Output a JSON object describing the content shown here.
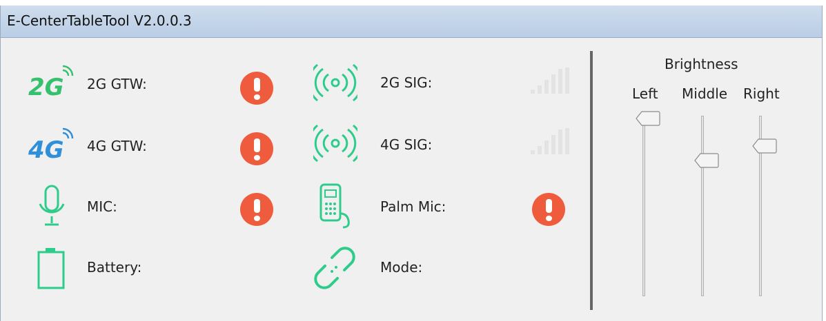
{
  "window": {
    "title": "E-CenterTableTool V2.0.0.3"
  },
  "status": {
    "gtw2g": {
      "label": "2G GTW:",
      "icon": "2g-signal-icon",
      "state": "alert"
    },
    "gtw4g": {
      "label": "4G GTW:",
      "icon": "4g-signal-icon",
      "state": "alert"
    },
    "mic": {
      "label": "MIC:",
      "icon": "microphone-icon",
      "state": "alert"
    },
    "battery": {
      "label": "Battery:",
      "icon": "battery-icon"
    },
    "sig2g": {
      "label": "2G SIG:",
      "icon": "wireless-broadcast-icon",
      "bars": 0
    },
    "sig4g": {
      "label": "4G SIG:",
      "icon": "wireless-broadcast-icon",
      "bars": 0
    },
    "palm_mic": {
      "label": "Palm Mic:",
      "icon": "handheld-mic-icon",
      "state": "alert"
    },
    "mode": {
      "label": "Mode:",
      "icon": "link-icon"
    }
  },
  "brightness": {
    "title": "Brightness",
    "left": {
      "label": "Left",
      "level": 1.0
    },
    "middle": {
      "label": "Middle",
      "level": 0.7
    },
    "right": {
      "label": "Right",
      "level": 0.8
    }
  },
  "colors": {
    "accent_green": "#2ecc8a",
    "alert_red": "#ef5b3d",
    "logo_2g": "#35c06e",
    "logo_4g": "#2f8fd8"
  }
}
